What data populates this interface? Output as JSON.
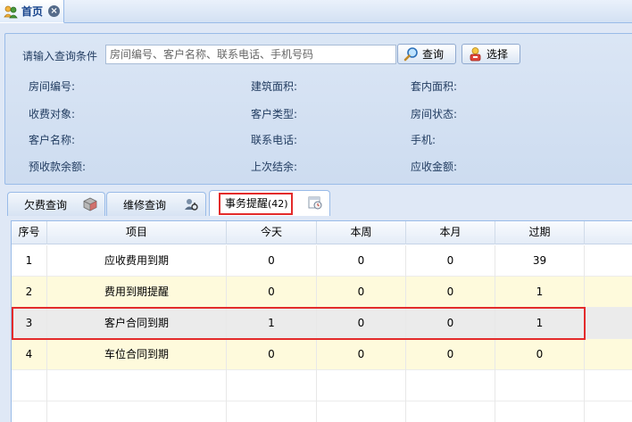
{
  "top_tab": {
    "label": "首页",
    "close": "×"
  },
  "query": {
    "label": "请输入查询条件",
    "placeholder": "房间编号、客户名称、联系电话、手机号码",
    "value": "",
    "query_button": "查询",
    "select_button": "选择"
  },
  "fields": {
    "room_no": "房间编号:",
    "building_area": "建筑面积:",
    "inner_area": "套内面积:",
    "charge_target": "收费对象:",
    "customer_type": "客户类型:",
    "room_status": "房间状态:",
    "customer_name": "客户名称:",
    "contact_phone": "联系电话:",
    "mobile": "手机:",
    "prepaid_balance": "预收款余额:",
    "last_settle": "上次结余:",
    "receivable": "应收金额:"
  },
  "tabs": [
    {
      "label": "欠费查询"
    },
    {
      "label": "维修查询"
    },
    {
      "label": "事务提醒",
      "count": "(42)"
    }
  ],
  "grid": {
    "columns": [
      "序号",
      "项目",
      "今天",
      "本周",
      "本月",
      "过期",
      ""
    ],
    "rows": [
      {
        "no": "1",
        "item": "应收费用到期",
        "today": "0",
        "week": "0",
        "month": "0",
        "overdue": "39"
      },
      {
        "no": "2",
        "item": "费用到期提醒",
        "today": "0",
        "week": "0",
        "month": "0",
        "overdue": "1"
      },
      {
        "no": "3",
        "item": "客户合同到期",
        "today": "1",
        "week": "0",
        "month": "0",
        "overdue": "1"
      },
      {
        "no": "4",
        "item": "车位合同到期",
        "today": "0",
        "week": "0",
        "month": "0",
        "overdue": "0"
      }
    ]
  },
  "colors": {
    "accent_border": "#99bbe8",
    "highlight_red": "#e32b2b",
    "row_alt": "#fefadc",
    "row_selected": "#ebebeb"
  }
}
